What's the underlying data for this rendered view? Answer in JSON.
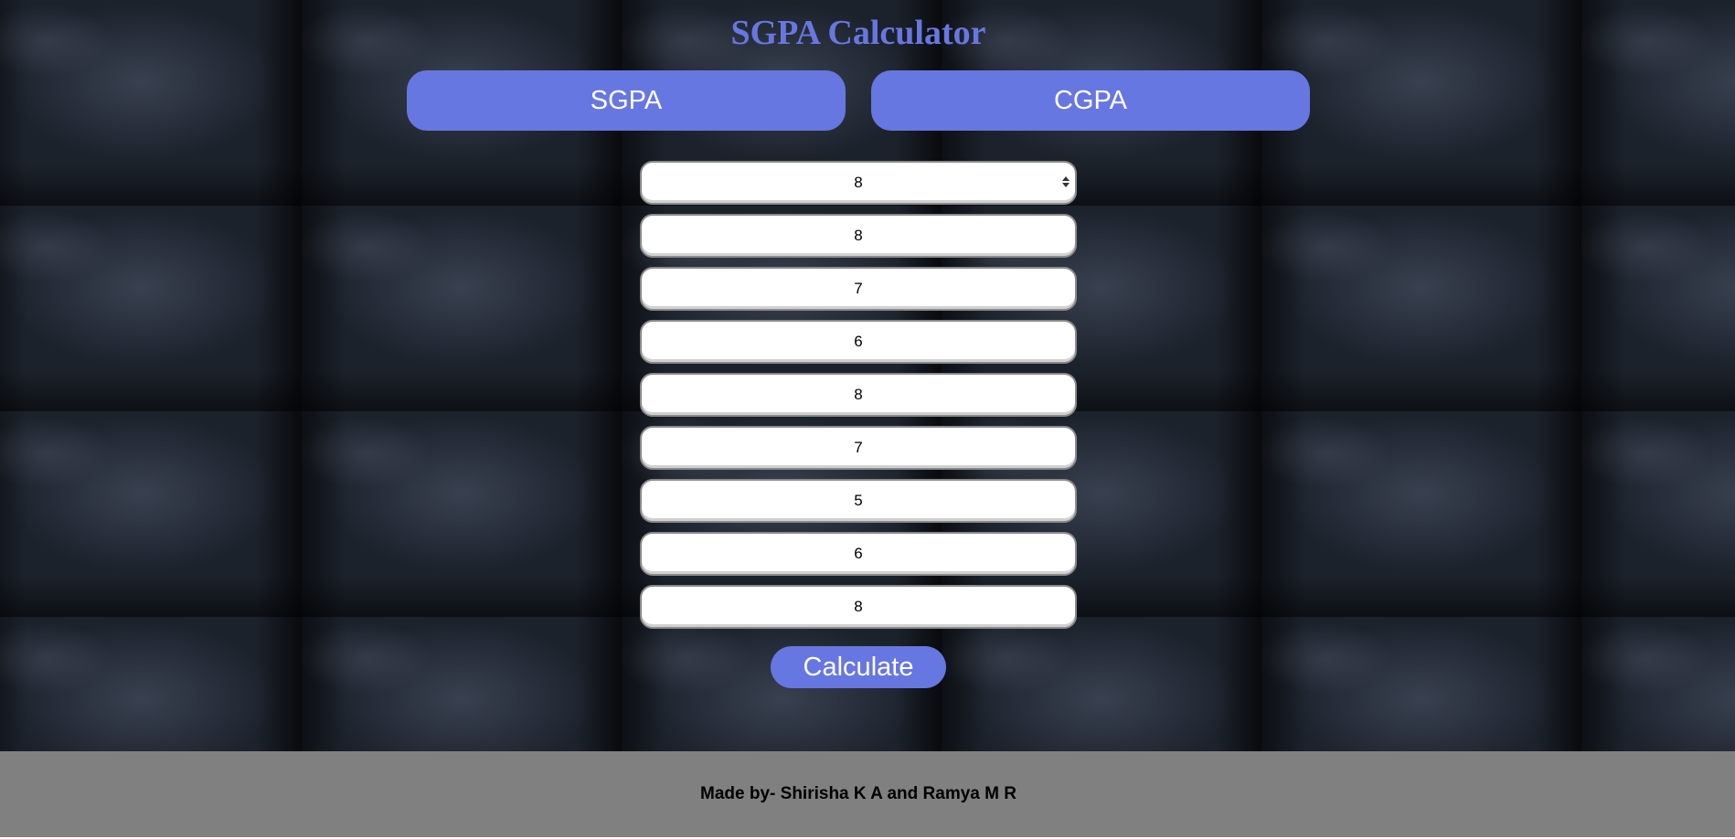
{
  "header": {
    "title": "SGPA Calculator"
  },
  "tabs": [
    {
      "label": "SGPA"
    },
    {
      "label": "CGPA"
    }
  ],
  "form": {
    "fields": [
      "8",
      "8",
      "7",
      "6",
      "8",
      "7",
      "5",
      "6",
      "8"
    ],
    "calculate_label": "Calculate"
  },
  "footer": {
    "text": "Made by- Shirisha K A and Ramya M R"
  },
  "colors": {
    "accent": "#6777e1",
    "title": "#6877e0",
    "footer_bg": "#808080"
  }
}
